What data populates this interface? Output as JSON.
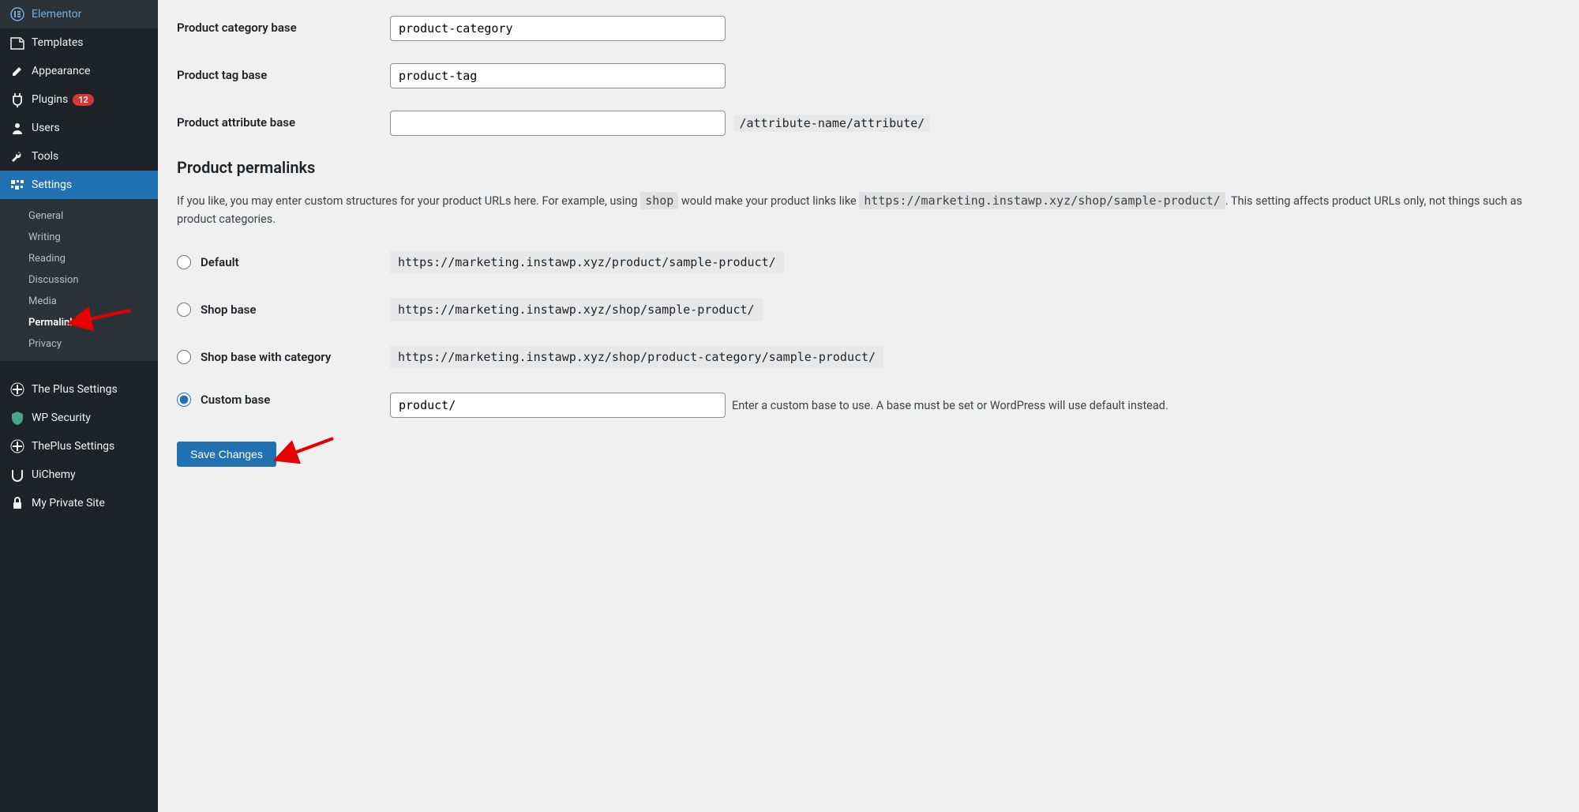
{
  "sidebar": {
    "items": [
      {
        "label": "Elementor",
        "icon": "elementor"
      },
      {
        "label": "Templates",
        "icon": "templates"
      },
      {
        "label": "Appearance",
        "icon": "appearance"
      },
      {
        "label": "Plugins",
        "icon": "plugins",
        "badge": "12"
      },
      {
        "label": "Users",
        "icon": "users"
      },
      {
        "label": "Tools",
        "icon": "tools"
      },
      {
        "label": "Settings",
        "icon": "settings",
        "current": true
      }
    ],
    "submenu": [
      {
        "label": "General"
      },
      {
        "label": "Writing"
      },
      {
        "label": "Reading"
      },
      {
        "label": "Discussion"
      },
      {
        "label": "Media"
      },
      {
        "label": "Permalinks",
        "current": true
      },
      {
        "label": "Privacy"
      }
    ],
    "extras": [
      {
        "label": "The Plus Settings",
        "icon": "plus"
      },
      {
        "label": "WP Security",
        "icon": "shield"
      },
      {
        "label": "ThePlus Settings",
        "icon": "plus"
      },
      {
        "label": "UiChemy",
        "icon": "ui"
      },
      {
        "label": "My Private Site",
        "icon": "lock"
      }
    ]
  },
  "fields": {
    "category_base": {
      "label": "Product category base",
      "value": "product-category"
    },
    "tag_base": {
      "label": "Product tag base",
      "value": "product-tag"
    },
    "attribute_base": {
      "label": "Product attribute base",
      "value": "",
      "hint": "/attribute-name/attribute/"
    }
  },
  "permalinks": {
    "title": "Product permalinks",
    "description_pre": "If you like, you may enter custom structures for your product URLs here. For example, using ",
    "description_code1": "shop",
    "description_mid": " would make your product links like ",
    "description_code2": "https://marketing.instawp.xyz/shop/sample-product/",
    "description_post": ". This setting affects product URLs only, not things such as product categories.",
    "options": [
      {
        "name": "Default",
        "url": "https://marketing.instawp.xyz/product/sample-product/",
        "checked": false
      },
      {
        "name": "Shop base",
        "url": "https://marketing.instawp.xyz/shop/sample-product/",
        "checked": false
      },
      {
        "name": "Shop base with category",
        "url": "https://marketing.instawp.xyz/shop/product-category/sample-product/",
        "checked": false
      }
    ],
    "custom": {
      "name": "Custom base",
      "value": "product/",
      "checked": true,
      "description": "Enter a custom base to use. A base must be set or WordPress will use default instead."
    }
  },
  "save_button": "Save Changes"
}
